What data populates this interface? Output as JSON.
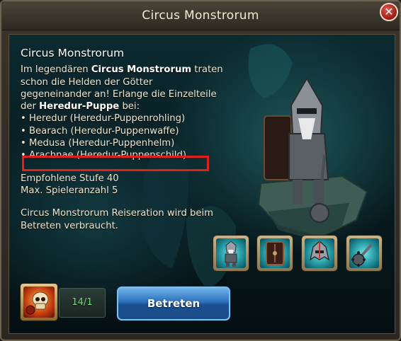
{
  "window": {
    "title": "Circus Monstrorum",
    "close_label": "✕"
  },
  "description": {
    "heading": "Circus Monstrorum",
    "intro_1": "Im legendären",
    "intro_strong_1": "Circus Monstrorum",
    "intro_2": "traten schon die Helden der Götter gegeneinander an! Erlange die Einzelteile der",
    "intro_strong_2": "Heredur-Puppe",
    "intro_3": "bei:",
    "bullets": [
      "Heredur (Heredur-Puppenrohling)",
      "Bearach (Heredur-Puppenwaffe)",
      "Medusa (Heredur-Puppenhelm)",
      "Arachnae (Heredur-Puppenschild)"
    ],
    "recommended_level": "Empfohlene Stufe 40",
    "max_players": "Max. Spieleranzahl 5",
    "travel_note": "Circus Monstrorum Reiseration wird beim Betreten verbraucht."
  },
  "rewards": [
    "doll-blank-icon",
    "shield-icon",
    "helmet-icon",
    "mace-icon"
  ],
  "entry": {
    "ration_count": "14/1",
    "enter_label": "Betreten"
  },
  "colors": {
    "highlight_border": "#e0201a",
    "counter_text": "#6fe07a",
    "enter_button": "#2a6fb9"
  }
}
